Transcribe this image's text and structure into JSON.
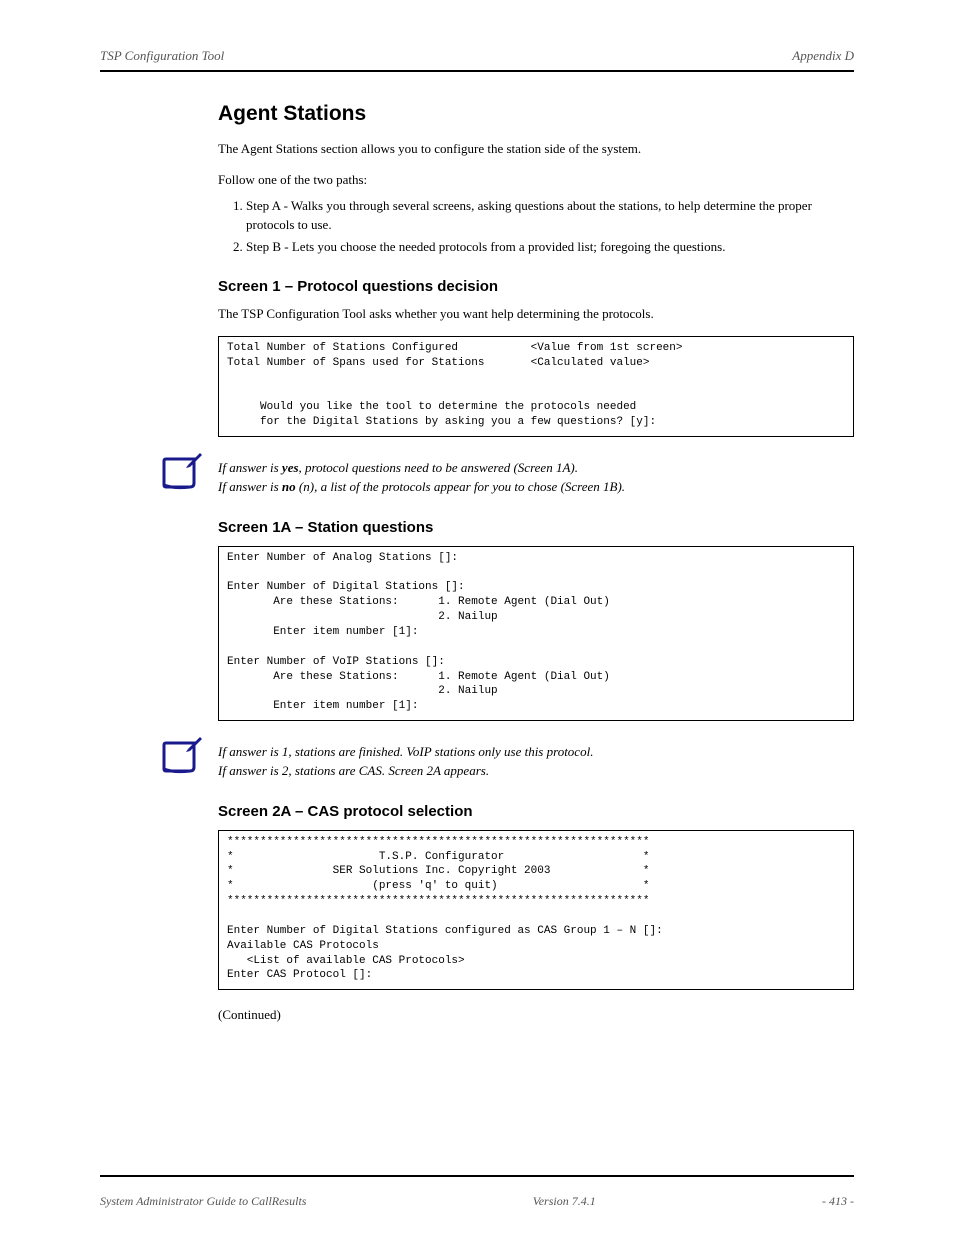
{
  "header": {
    "left": "TSP Configuration Tool",
    "right": "Appendix D"
  },
  "section": {
    "title": "Agent Stations",
    "intro": "The Agent Stations section allows you to configure the station side of the system.",
    "step_intro": "Follow one of the two paths:",
    "steps": [
      "Step A - Walks you through several screens, asking questions about the stations, to help determine the proper protocols to use.",
      "Step B - Lets you choose the needed protocols from a provided list; foregoing the questions."
    ]
  },
  "screen1": {
    "title": "Screen 1 – Protocol questions decision",
    "desc": "The TSP Configuration Tool asks whether you want help determining the protocols.",
    "code": "Total Number of Stations Configured           <Value from 1st screen>\nTotal Number of Spans used for Stations       <Calculated value>\n\n\n     Would you like the tool to determine the protocols needed\n     for the Digital Stations by asking you a few questions? [y]:"
  },
  "note1": {
    "text_a": "If answer is ",
    "yes": "yes",
    "text_b": ", protocol questions need to be answered (Screen 1A).",
    "text_c": "If answer is ",
    "no": "no",
    "text_d": " (n), a list of the protocols appear for you to chose (Screen 1B)."
  },
  "screen1a": {
    "title": "Screen 1A – Station questions",
    "code": "Enter Number of Analog Stations []:\n\nEnter Number of Digital Stations []:\n       Are these Stations:      1. Remote Agent (Dial Out)\n                                2. Nailup\n       Enter item number [1]:\n\nEnter Number of VoIP Stations []:\n       Are these Stations:      1. Remote Agent (Dial Out)\n                                2. Nailup\n       Enter item number [1]:"
  },
  "note2": {
    "text": "If answer is 1, stations are finished. VoIP stations only use this protocol.\nIf answer is 2, stations are CAS. Screen 2A appears."
  },
  "screen2a": {
    "title": "Screen 2A – CAS protocol selection",
    "code": "****************************************************************\n*                      T.S.P. Configurator                     *\n*               SER Solutions Inc. Copyright 2003              *\n*                     (press 'q' to quit)                      *\n****************************************************************\n\nEnter Number of Digital Stations configured as CAS Group 1 – N []:\nAvailable CAS Protocols\n   <List of available CAS Protocols>\nEnter CAS Protocol []:"
  },
  "continuation": "(Continued)",
  "footer": {
    "left": "System Administrator Guide to CallResults",
    "center": "Version 7.4.1",
    "right": "- 413 -"
  }
}
